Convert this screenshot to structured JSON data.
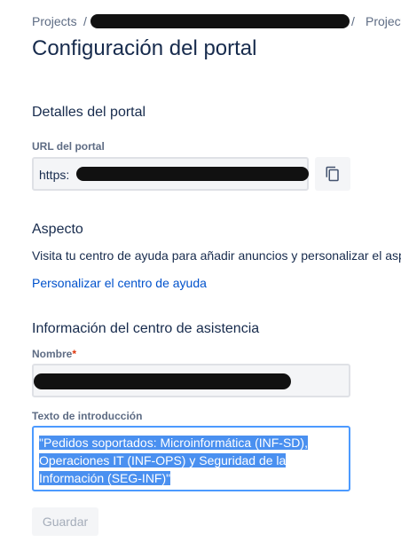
{
  "breadcrumb": {
    "projects": "Projects",
    "separator": "/",
    "last": "Project"
  },
  "page": {
    "title": "Configuración del portal"
  },
  "portal_details": {
    "title": "Detalles del portal",
    "url_label": "URL del portal",
    "url_value": "https:"
  },
  "appearance": {
    "title": "Aspecto",
    "description": "Visita tu centro de ayuda para añadir anuncios y personalizar el aspe",
    "link": "Personalizar el centro de ayuda"
  },
  "help_center": {
    "title": "Información del centro de asistencia",
    "name_label": "Nombre",
    "required_mark": "*",
    "intro_label": "Texto de introducción",
    "intro_lines": [
      "\"Pedidos soportados: Microinformática (INF-SD),",
      "Operaciones IT (INF-OPS)  y  Seguridad de la",
      "Información (SEG-INF)\""
    ]
  },
  "actions": {
    "save_label": "Guardar"
  },
  "icons": {
    "copy": "copy-icon"
  },
  "colors": {
    "link": "#0052cc",
    "selection": "#4a90f0",
    "focus_border": "#4c9aff",
    "required": "#de350b"
  }
}
